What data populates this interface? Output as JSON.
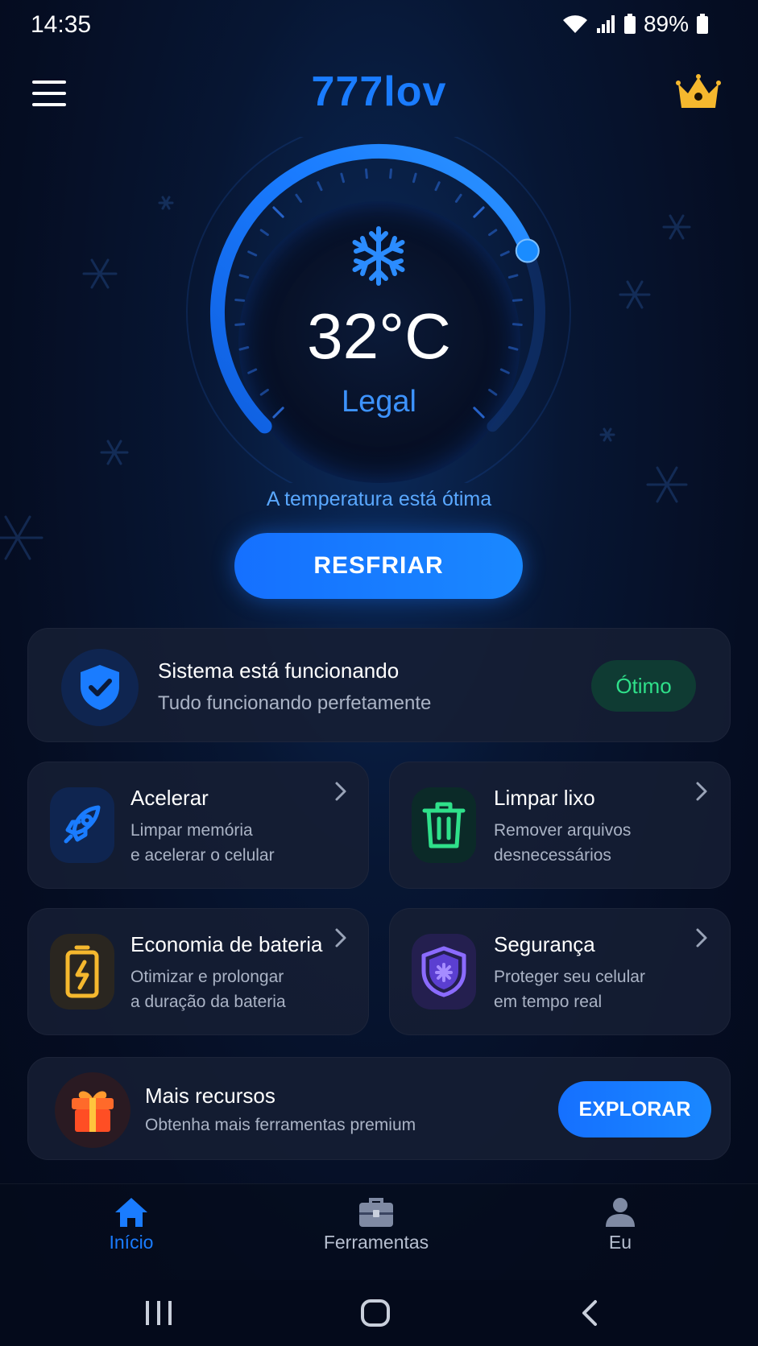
{
  "status_bar": {
    "time": "14:35",
    "battery": "89%",
    "icons": [
      "wifi-icon",
      "signal-icon",
      "battery-saver-icon",
      "battery-icon"
    ]
  },
  "header": {
    "app_title": "777lov",
    "menu_icon": "menu-icon",
    "premium_icon": "crown-icon"
  },
  "thermometer": {
    "icon": "snowflake-icon",
    "temperature": "32°C",
    "status": "Legal",
    "message": "A temperatura está ótima",
    "gauge_level": 0.75
  },
  "cool_button": {
    "label": "RESFRIAR"
  },
  "system_card": {
    "icon": "shield-check-icon",
    "title": "Sistema está funcionando",
    "subtitle": "Tudo funcionando perfetamente",
    "badge": "Ótimo"
  },
  "features": [
    {
      "icon": "rocket-icon",
      "title": "Acelerar",
      "description": "Limpar memória\ne acelerar o celular"
    },
    {
      "icon": "trash-icon",
      "title": "Limpar lixo",
      "description": "Remover arquivos\ndesnecessários"
    },
    {
      "icon": "battery-charge-icon",
      "title": "Economia de bateria",
      "description": "Otimizar e prolongar\na duração da bateria"
    },
    {
      "icon": "security-shield-icon",
      "title": "Segurança",
      "description": "Proteger seu celular\nem tempo real"
    }
  ],
  "more_card": {
    "icon": "gift-icon",
    "title": "Mais recursos",
    "subtitle": "Obtenha mais ferramentas premium",
    "button": "EXPLORAR"
  },
  "bottom_nav": {
    "items": [
      {
        "icon": "home-icon",
        "label": "Início",
        "active": true
      },
      {
        "icon": "toolbox-icon",
        "label": "Ferramentas",
        "active": false
      },
      {
        "icon": "person-icon",
        "label": "Eu",
        "active": false
      }
    ]
  },
  "system_nav": [
    "recent-apps-icon",
    "home-circle-icon",
    "back-icon"
  ],
  "colors": {
    "accent": "#1a7cff",
    "background": "#050d22",
    "success": "#2fe08a",
    "warning": "#f5b82e",
    "purple": "#7b5cff"
  }
}
